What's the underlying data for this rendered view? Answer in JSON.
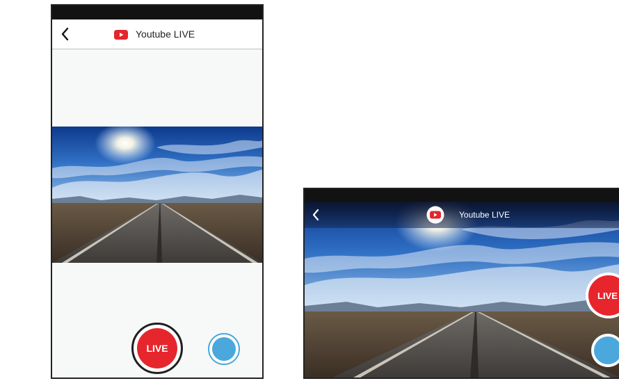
{
  "app": {
    "title": "Youtube LIVE"
  },
  "portrait": {
    "header": {
      "title": "Youtube LIVE"
    },
    "controls": {
      "live_label": "LIVE"
    }
  },
  "landscape": {
    "header": {
      "title": "Youtube LIVE"
    },
    "controls": {
      "live_label": "LIVE"
    }
  },
  "icons": {
    "back": "back-arrow-icon",
    "youtube": "youtube-logo-icon",
    "camera_switch": "camera-switch-button"
  },
  "colors": {
    "live_red": "#e6262c",
    "camera_blue": "#4aa8dc",
    "youtube_red": "#e5262b",
    "status_bar": "#121212"
  }
}
